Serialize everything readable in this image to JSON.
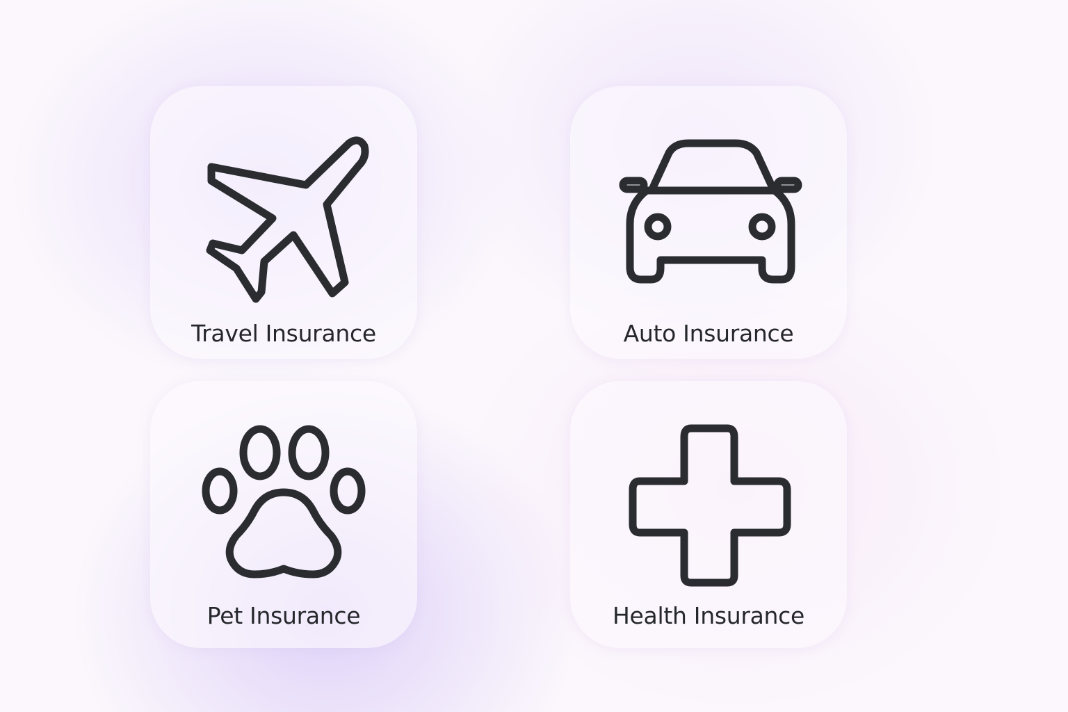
{
  "tiles": [
    {
      "label": "Travel Insurance",
      "icon": "airplane-icon"
    },
    {
      "label": "Auto Insurance",
      "icon": "car-icon"
    },
    {
      "label": "Pet Insurance",
      "icon": "paw-icon"
    },
    {
      "label": "Health Insurance",
      "icon": "medical-cross-icon"
    }
  ],
  "colors": {
    "icon_stroke": "#2a2c30",
    "label_text": "#25272b",
    "tile_background": "#fcf8fd",
    "page_background": "#fbf7fc"
  }
}
